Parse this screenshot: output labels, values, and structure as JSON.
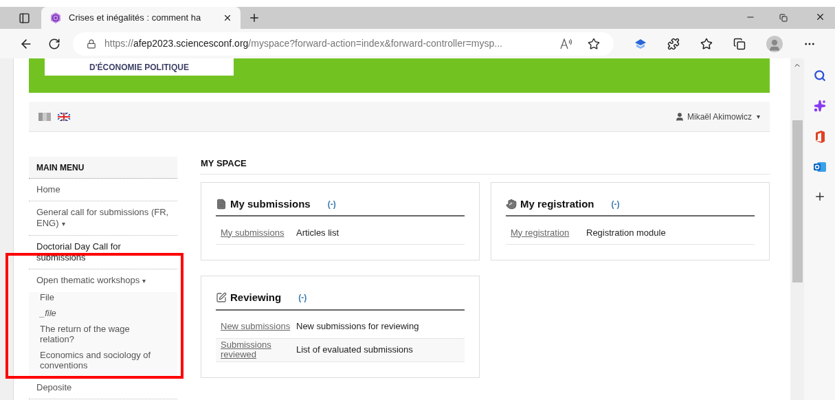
{
  "browser": {
    "tab_title": "Crises et inégalités : comment ha",
    "url_prefix": "https://",
    "url_host": "afep2023.sciencesconf.org",
    "url_path": "/myspace?forward-action=index&forward-controller=mysp..."
  },
  "banner": {
    "logo_text": "D'ÉCONOMIE POLITIQUE"
  },
  "user_menu": {
    "name": "Mikaël Akimowicz",
    "caret": "▾"
  },
  "main_menu": {
    "title": "MAIN MENU",
    "items": [
      {
        "label": "Home"
      },
      {
        "label": "General call for submissions (FR, ENG)",
        "caret": "▾"
      },
      {
        "label": "Doctorial Day Call for submissions"
      },
      {
        "label": "Open thematic workshops",
        "caret": "▾",
        "children": [
          {
            "label": "File",
            "italic": false
          },
          {
            "label": "_file",
            "italic": true
          },
          {
            "label": "The return of the wage relation?",
            "italic": false
          },
          {
            "label": "Economics and sociology of conventions",
            "italic": false
          }
        ]
      },
      {
        "label": "Deposite"
      }
    ]
  },
  "my_space": {
    "title": "MY SPACE",
    "panels": [
      {
        "kind": "file",
        "title": "My submissions",
        "toggle": "(-)",
        "rows": [
          {
            "link": "My submissions",
            "text": "Articles list"
          }
        ]
      },
      {
        "kind": "hand",
        "title": "My registration",
        "toggle": "(-)",
        "rows": [
          {
            "link": "My registration",
            "text": "Registration module"
          }
        ]
      },
      {
        "kind": "edit",
        "title": "Reviewing",
        "toggle": "(-)",
        "rows": [
          {
            "link": "New submissions",
            "text": "New submissions for reviewing"
          },
          {
            "link": "Submissions reviewed",
            "text": "List of evaluated submissions"
          }
        ]
      }
    ]
  }
}
